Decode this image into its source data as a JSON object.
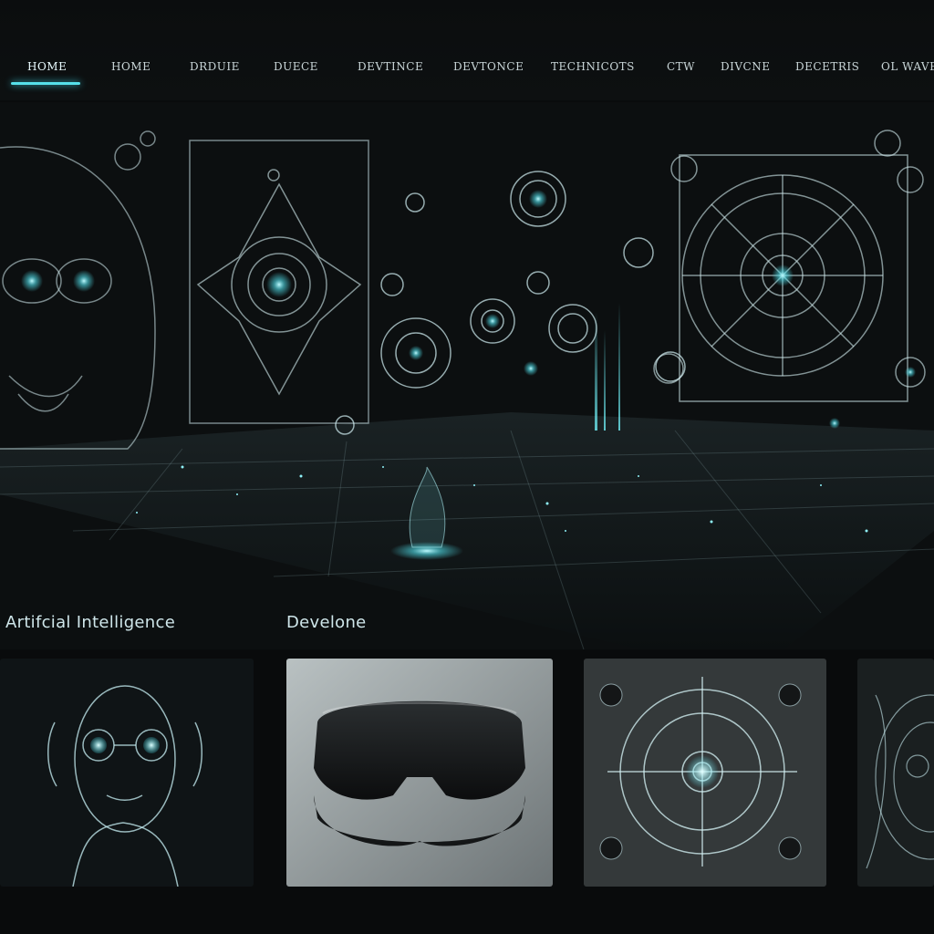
{
  "nav": {
    "items": [
      {
        "label": "HOME",
        "active": true
      },
      {
        "label": "HOME"
      },
      {
        "label": "DRDUIE"
      },
      {
        "label": "DUECE"
      },
      {
        "label": "DEVTINCE"
      },
      {
        "label": "DEVTONCE"
      },
      {
        "label": "TECHNICOTS"
      },
      {
        "label": "CTW"
      },
      {
        "label": "DIVCNE"
      },
      {
        "label": "DECETRIS"
      },
      {
        "label": "OL WAVE"
      }
    ],
    "accent": "#56e0ea"
  },
  "sections": {
    "ai_title": "Artifcial Intelligence",
    "dev_title": "Develone"
  },
  "cards": [
    {
      "icon": "ai-head-icon"
    },
    {
      "icon": "vr-headset-icon"
    },
    {
      "icon": "holo-disc-icon"
    },
    {
      "icon": "abstract-face-icon"
    }
  ]
}
